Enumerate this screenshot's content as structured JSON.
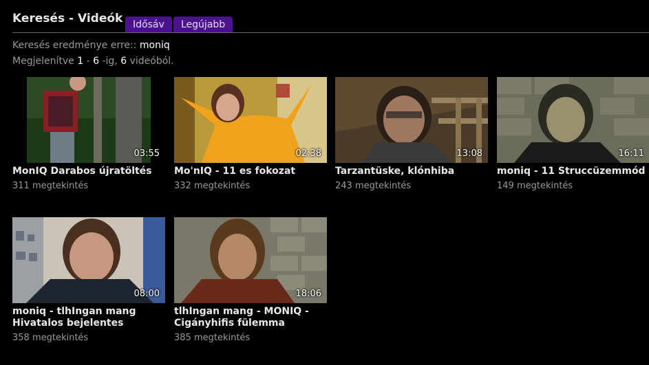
{
  "header": {
    "title": "Keresés - Videók",
    "tabs": [
      {
        "label": "Idősáv"
      },
      {
        "label": "Legújabb"
      }
    ]
  },
  "results": {
    "query_label": "Keresés eredménye erre::",
    "query": "moniq",
    "showing_prefix": "Megjelenítve",
    "from": "1",
    "dash": "-",
    "to": "6",
    "to_suffix": "-ig,",
    "total": "6",
    "total_suffix": "videóból."
  },
  "videos": [
    {
      "title": "MonIQ Darabos újratöltés",
      "views": "311 megtekintés",
      "duration": "03:55",
      "thumb": "forest"
    },
    {
      "title": "Mo'nIQ - 11 es fokozat",
      "views": "332 megtekintés",
      "duration": "02:38",
      "thumb": "yellow"
    },
    {
      "title": "Tarzantüske, klónhiba",
      "views": "243 megtekintés",
      "duration": "13:08",
      "thumb": "attic"
    },
    {
      "title": "moniq - 11 Struccüzemmód",
      "views": "149 megtekintés",
      "duration": "16:11",
      "thumb": "brickcap"
    },
    {
      "title": "moniq - tlhIngan mang Hivatalos bejelentes",
      "views": "358 megtekintés",
      "duration": "08:00",
      "thumb": "room"
    },
    {
      "title": "tlhIngan mang - MONIQ - Cigányhifis fülemma",
      "views": "385 megtekintés",
      "duration": "18:06",
      "thumb": "brick"
    }
  ]
}
